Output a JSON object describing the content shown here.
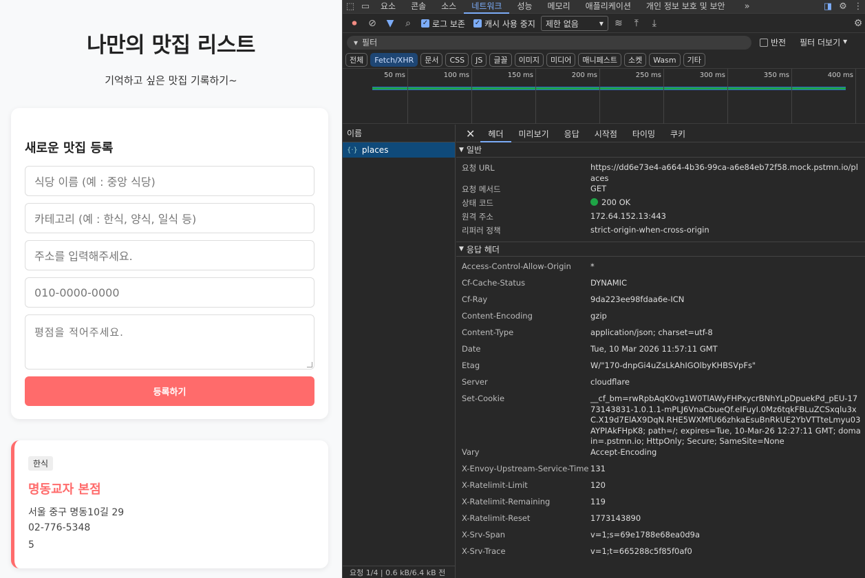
{
  "app": {
    "title": "나만의 맛집 리스트",
    "subtitle": "기억하고 싶은 맛집 기록하기~",
    "form": {
      "heading": "새로운 맛집 등록",
      "name_placeholder": "식당 이름 (예 : 중앙 식당)",
      "category_placeholder": "카테고리 (예 : 한식, 양식, 일식 등)",
      "address_placeholder": "주소를 입력해주세요.",
      "phone_placeholder": "010-0000-0000",
      "review_placeholder": "평점을 적어주세요.",
      "submit_label": "등록하기"
    },
    "place": {
      "category": "한식",
      "name": "명동교자 본점",
      "address": "서울 중구 명동10길 29",
      "phone": "02-776-5348",
      "rating": "5"
    },
    "accent_color": "#ff6b6b"
  },
  "devtools": {
    "tabs": [
      "요소",
      "콘솔",
      "소스",
      "네트워크",
      "성능",
      "메모리",
      "애플리케이션",
      "개인 정보 보호 및 보안"
    ],
    "active_tab": "네트워크",
    "toolbar": {
      "preserve_log": "로그 보존",
      "disable_cache": "캐시 사용 중지",
      "throttle": "제한 없음"
    },
    "filter": {
      "placeholder": "필터",
      "invert": "반전",
      "more_filters": "필터 더보기"
    },
    "types": [
      "전체",
      "Fetch/XHR",
      "문서",
      "CSS",
      "JS",
      "글꼴",
      "이미지",
      "미디어",
      "매니페스트",
      "소켓",
      "Wasm",
      "기타"
    ],
    "active_type": "Fetch/XHR",
    "timeline_ticks": [
      "50 ms",
      "100 ms",
      "150 ms",
      "200 ms",
      "250 ms",
      "300 ms",
      "350 ms",
      "400 ms"
    ],
    "requests": {
      "header": "이름",
      "items": [
        "places"
      ],
      "footer": "요청 1/4 | 0.6 kB/6.4 kB 전"
    },
    "detail_tabs": [
      "헤더",
      "미리보기",
      "응답",
      "시작점",
      "타이밍",
      "쿠키"
    ],
    "active_detail_tab": "헤더",
    "general": {
      "title": "일반",
      "rows": [
        {
          "k": "요청 URL",
          "v": "https://dd6e73e4-a664-4b36-99ca-a6e84eb72f58.mock.pstmn.io/places"
        },
        {
          "k": "요청 메서드",
          "v": "GET"
        },
        {
          "k": "상태 코드",
          "v": "200 OK"
        },
        {
          "k": "원격 주소",
          "v": "172.64.152.13:443"
        },
        {
          "k": "리퍼러 정책",
          "v": "strict-origin-when-cross-origin"
        }
      ]
    },
    "response_headers": {
      "title": "응답 헤더",
      "rows": [
        {
          "k": "Access-Control-Allow-Origin",
          "v": "*"
        },
        {
          "k": "Cf-Cache-Status",
          "v": "DYNAMIC"
        },
        {
          "k": "Cf-Ray",
          "v": "9da223ee98fdaa6e-ICN"
        },
        {
          "k": "Content-Encoding",
          "v": "gzip"
        },
        {
          "k": "Content-Type",
          "v": "application/json; charset=utf-8"
        },
        {
          "k": "Date",
          "v": "Tue, 10 Mar 2026 11:57:11 GMT"
        },
        {
          "k": "Etag",
          "v": "W/\"170-dnpGi4uZsLkAhIGOlbyKHBSVpFs\""
        },
        {
          "k": "Server",
          "v": "cloudflare"
        },
        {
          "k": "Set-Cookie",
          "v": "__cf_bm=rwRpbAqK0vg1W0TlAWyFHPxycrBNhYLpDpuekPd_pEU-1773143831-1.0.1.1-mPLJ6VnaCbueQf.eIFuyI.0Mz6tqkFBLuZCSxqlu3xC.X19d7ElAX9DqN.RHE5WXMfU66zhkaEsuBnRkUE2YbVTTteLmyu03AYPIAkFHpK8; path=/; expires=Tue, 10-Mar-26 12:27:11 GMT; domain=.pstmn.io; HttpOnly; Secure; SameSite=None"
        },
        {
          "k": "Vary",
          "v": "Accept-Encoding"
        },
        {
          "k": "X-Envoy-Upstream-Service-Time",
          "v": "131"
        },
        {
          "k": "X-Ratelimit-Limit",
          "v": "120"
        },
        {
          "k": "X-Ratelimit-Remaining",
          "v": "119"
        },
        {
          "k": "X-Ratelimit-Reset",
          "v": "1773143890"
        },
        {
          "k": "X-Srv-Span",
          "v": "v=1;s=69e1788e68ea0d9a"
        },
        {
          "k": "X-Srv-Trace",
          "v": "v=1;t=665288c5f85f0af0"
        }
      ]
    },
    "status_color": "#1ea446"
  }
}
